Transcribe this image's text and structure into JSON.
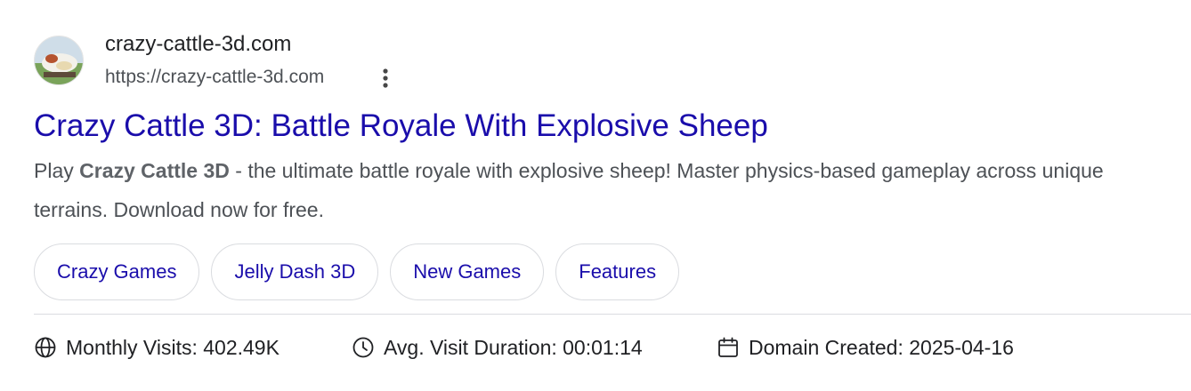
{
  "result": {
    "site_name": "crazy-cattle-3d.com",
    "url": "https://crazy-cattle-3d.com",
    "title": "Crazy Cattle 3D: Battle Royale With Explosive Sheep",
    "snippet": {
      "prefix": "Play ",
      "bold": "Crazy Cattle 3D",
      "rest": " - the ultimate battle royale with explosive sheep! Master physics-based gameplay across unique terrains. Download now for free."
    },
    "chips": [
      "Crazy Games",
      "Jelly Dash 3D",
      "New Games",
      "Features"
    ],
    "stats": {
      "monthly_visits": "Monthly Visits: 402.49K",
      "avg_visit_duration": "Avg. Visit Duration: 00:01:14",
      "domain_created": "Domain Created: 2025-04-16"
    },
    "icons": {
      "favicon": "site-favicon",
      "menu": "more-vert-icon",
      "visits": "globe-icon",
      "duration": "clock-icon",
      "created": "calendar-icon"
    },
    "colors": {
      "link": "#1a0dab",
      "text": "#4d5156",
      "chip_border": "#dadce0"
    }
  }
}
